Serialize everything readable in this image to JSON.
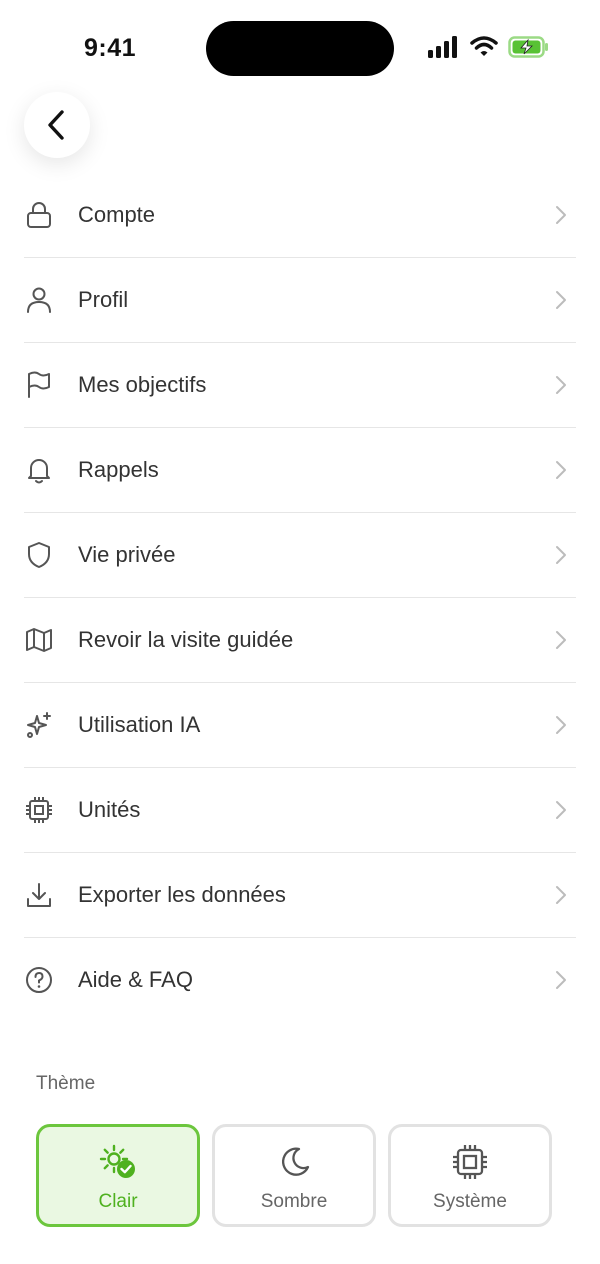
{
  "status_bar": {
    "time": "9:41"
  },
  "menu": {
    "items": [
      {
        "label": "Compte",
        "icon": "lock-icon"
      },
      {
        "label": "Profil",
        "icon": "user-icon"
      },
      {
        "label": "Mes objectifs",
        "icon": "flag-icon"
      },
      {
        "label": "Rappels",
        "icon": "bell-icon"
      },
      {
        "label": "Vie privée",
        "icon": "shield-icon"
      },
      {
        "label": "Revoir la visite guidée",
        "icon": "map-icon"
      },
      {
        "label": "Utilisation IA",
        "icon": "sparkles-icon"
      },
      {
        "label": "Unités",
        "icon": "chip-icon"
      },
      {
        "label": "Exporter les données",
        "icon": "download-icon"
      },
      {
        "label": "Aide & FAQ",
        "icon": "help-circle-icon"
      }
    ]
  },
  "theme": {
    "title": "Thème",
    "options": [
      {
        "label": "Clair",
        "icon": "sun-icon",
        "selected": true
      },
      {
        "label": "Sombre",
        "icon": "moon-icon",
        "selected": false
      },
      {
        "label": "Système",
        "icon": "chip-icon",
        "selected": false
      }
    ]
  },
  "colors": {
    "accent": "#6cc63d",
    "accent_bg": "#eaf8e2",
    "battery": "#58c234"
  }
}
